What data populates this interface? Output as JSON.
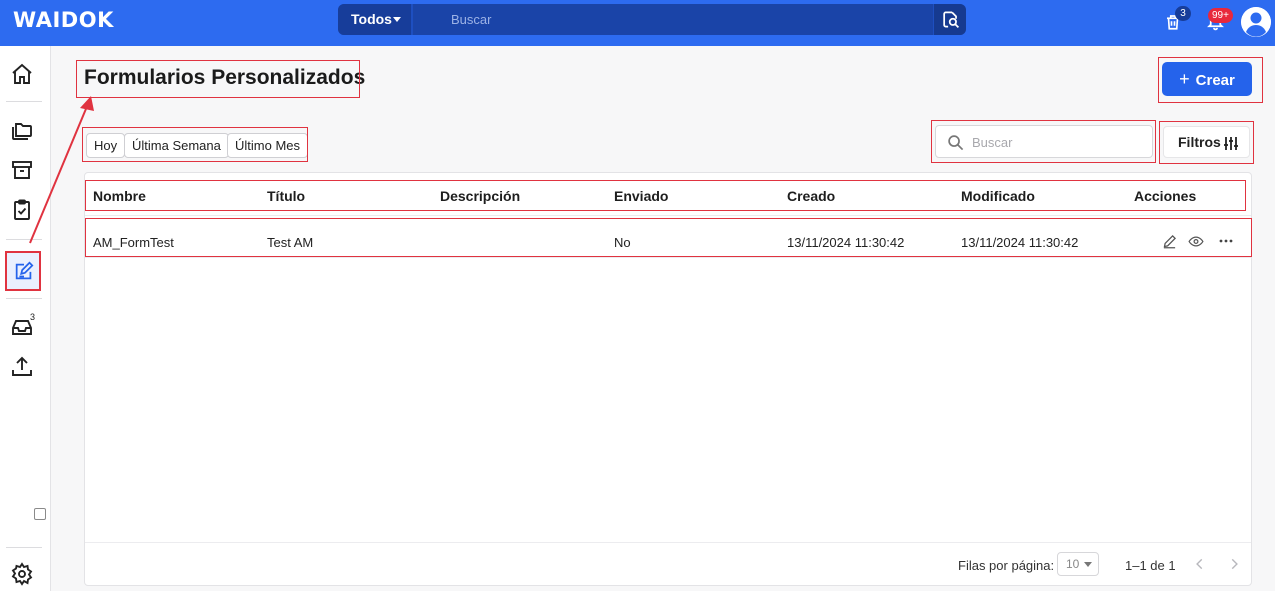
{
  "app": {
    "logo": "WAIDOK"
  },
  "topbar": {
    "scope": "Todos",
    "search_placeholder": "Buscar",
    "trash_count": "3",
    "notifications_count": "99+"
  },
  "sidebar": {
    "items": [
      {
        "icon": "home-icon"
      },
      {
        "icon": "folders-icon"
      },
      {
        "icon": "archive-icon"
      },
      {
        "icon": "clipboard-check-icon"
      },
      {
        "icon": "form-edit-icon",
        "active": true
      },
      {
        "icon": "inbox-icon",
        "count": "3"
      },
      {
        "icon": "upload-icon"
      },
      {
        "icon": "gear-icon"
      }
    ]
  },
  "page": {
    "title": "Formularios Personalizados",
    "create_label": "Crear",
    "date_filters": [
      "Hoy",
      "Última Semana",
      "Último Mes"
    ],
    "search_placeholder": "Buscar",
    "filters_label": "Filtros"
  },
  "table": {
    "columns": [
      "Nombre",
      "Título",
      "Descripción",
      "Enviado",
      "Creado",
      "Modificado",
      "Acciones"
    ],
    "rows": [
      {
        "nombre": "AM_FormTest",
        "titulo": "Test AM",
        "descripcion": "",
        "enviado": "No",
        "creado": "13/11/2024 11:30:42",
        "modificado": "13/11/2024 11:30:42"
      }
    ]
  },
  "pagination": {
    "rows_per_page_label": "Filas por página:",
    "rows_per_page": "10",
    "range": "1–1 de 1"
  },
  "colors": {
    "brand": "#2d6bf0",
    "accent": "#2563eb",
    "highlight": "#e03340",
    "badge": "#e8283c"
  }
}
